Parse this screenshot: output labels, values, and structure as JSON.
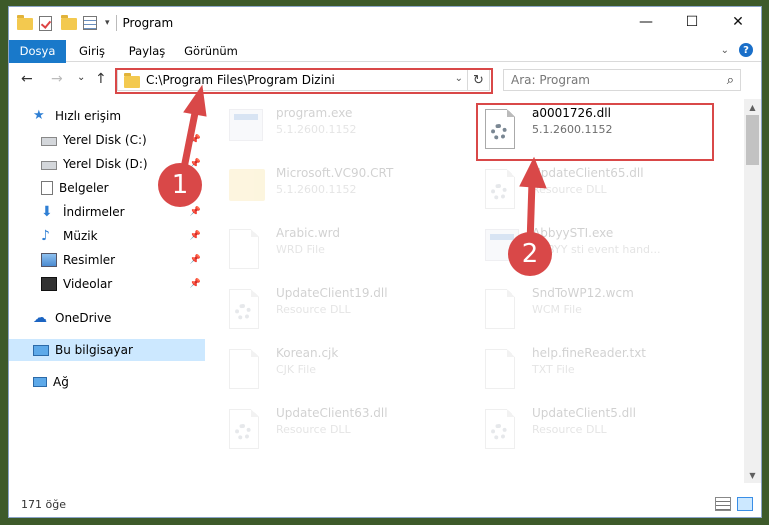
{
  "window": {
    "title": "Program",
    "controls": {
      "minimize": "—",
      "maximize": "☐",
      "close": "✕"
    }
  },
  "ribbon": {
    "tabs": [
      "Dosya",
      "Giriş",
      "Paylaş",
      "Görünüm"
    ]
  },
  "nav": {
    "back": "←",
    "forward": "→",
    "recent": "⌄",
    "up": "↑",
    "address": "C:\\Program Files\\Program Dizini",
    "refresh": "↻",
    "search_placeholder": "Ara: Program",
    "search_icon": "⌕"
  },
  "sidebar": {
    "items": [
      {
        "label": "Hızlı erişim",
        "icon": "star-icon",
        "pinned": false
      },
      {
        "label": "Yerel Disk (C:)",
        "icon": "drive-icon",
        "pinned": true
      },
      {
        "label": "Yerel Disk (D:)",
        "icon": "drive-icon",
        "pinned": true
      },
      {
        "label": "Belgeler",
        "icon": "documents-icon",
        "pinned": true
      },
      {
        "label": "İndirmeler",
        "icon": "download-icon",
        "pinned": true
      },
      {
        "label": "Müzik",
        "icon": "music-icon",
        "pinned": true
      },
      {
        "label": "Resimler",
        "icon": "pictures-icon",
        "pinned": true
      },
      {
        "label": "Videolar",
        "icon": "videos-icon",
        "pinned": true
      },
      {
        "label": "OneDrive",
        "icon": "cloud-icon",
        "pinned": false
      },
      {
        "label": "Bu bilgisayar",
        "icon": "computer-icon",
        "pinned": false,
        "selected": true
      },
      {
        "label": "Ağ",
        "icon": "network-icon",
        "pinned": false
      }
    ]
  },
  "files": [
    {
      "name": "program.exe",
      "sub": "5.1.2600.1152",
      "icon": "exe-icon",
      "faded": true
    },
    {
      "name": "a0001726.dll",
      "sub": "5.1.2600.1152",
      "icon": "dll-gear-icon",
      "faded": false
    },
    {
      "name": "Microsoft.VC90.CRT",
      "sub": "5.1.2600.1152",
      "icon": "folder-icon",
      "faded": true
    },
    {
      "name": "UpdateClient65.dll",
      "sub": "Resource DLL",
      "icon": "dll-gear-icon",
      "faded": true
    },
    {
      "name": "Arabic.wrd",
      "sub": "WRD File",
      "icon": "document-icon",
      "faded": true
    },
    {
      "name": "AbbyySTI.exe",
      "sub": "ABBYY sti event hand...",
      "icon": "exe-icon",
      "faded": true
    },
    {
      "name": "UpdateClient19.dll",
      "sub": "Resource DLL",
      "icon": "dll-gear-icon",
      "faded": true
    },
    {
      "name": "SndToWP12.wcm",
      "sub": "WCM File",
      "icon": "document-icon",
      "faded": true
    },
    {
      "name": "Korean.cjk",
      "sub": "CJK File",
      "icon": "document-icon",
      "faded": true
    },
    {
      "name": "help.fineReader.txt",
      "sub": "TXT File",
      "icon": "document-icon",
      "faded": true
    },
    {
      "name": "UpdateClient63.dll",
      "sub": "Resource DLL",
      "icon": "dll-gear-icon",
      "faded": true
    },
    {
      "name": "UpdateClient5.dll",
      "sub": "Resource DLL",
      "icon": "dll-gear-icon",
      "faded": true
    }
  ],
  "status": {
    "item_count": "171 öğe"
  },
  "callouts": [
    "1",
    "2"
  ],
  "colors": {
    "accent": "#1979ca",
    "highlight": "#d94848",
    "selected_bg": "#cce8ff"
  }
}
